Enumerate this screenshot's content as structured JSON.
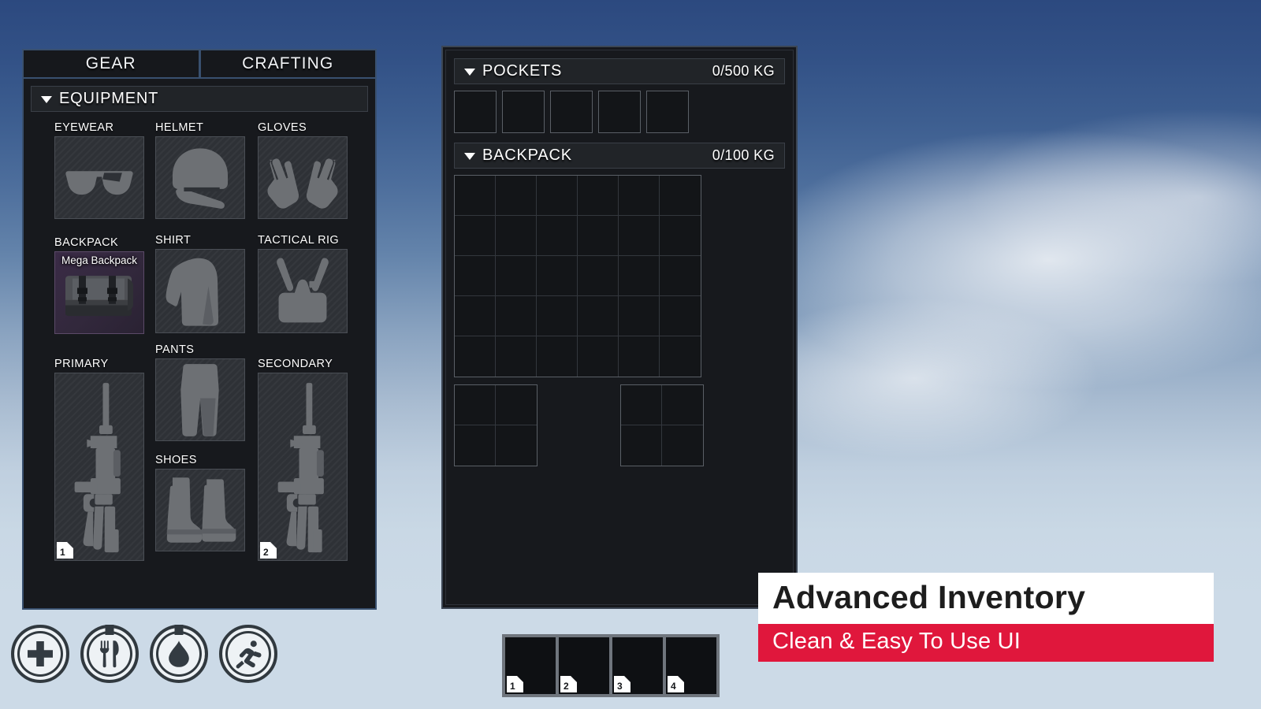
{
  "tabs": [
    {
      "label": "GEAR",
      "active": true
    },
    {
      "label": "CRAFTING",
      "active": false
    }
  ],
  "equipment_section": {
    "title": "EQUIPMENT",
    "caret": "chevron-down-icon"
  },
  "equipment_slots": [
    {
      "id": "eyewear",
      "label": "EYEWEAR",
      "item": null,
      "hotkey": null,
      "icon": "sunglasses-icon"
    },
    {
      "id": "helmet",
      "label": "HELMET",
      "item": null,
      "hotkey": null,
      "icon": "helmet-icon"
    },
    {
      "id": "gloves",
      "label": "GLOVES",
      "item": null,
      "hotkey": null,
      "icon": "gloves-icon"
    },
    {
      "id": "backpack",
      "label": "BACKPACK",
      "item": "Mega Backpack",
      "hotkey": null,
      "icon": "backpack-icon"
    },
    {
      "id": "shirt",
      "label": "SHIRT",
      "item": null,
      "hotkey": null,
      "icon": "shirt-icon"
    },
    {
      "id": "rig",
      "label": "TACTICAL RIG",
      "item": null,
      "hotkey": null,
      "icon": "tactical-rig-icon"
    },
    {
      "id": "primary",
      "label": "PRIMARY",
      "item": null,
      "hotkey": "1",
      "icon": "rifle-icon"
    },
    {
      "id": "pants",
      "label": "PANTS",
      "item": null,
      "hotkey": null,
      "icon": "pants-icon"
    },
    {
      "id": "secondary",
      "label": "SECONDARY",
      "item": null,
      "hotkey": "2",
      "icon": "rifle-icon"
    },
    {
      "id": "shoes",
      "label": "SHOES",
      "item": null,
      "hotkey": null,
      "icon": "boots-icon"
    }
  ],
  "pockets": {
    "title": "POCKETS",
    "capacity": "0/500 KG",
    "slot_count": 5
  },
  "backpack_storage": {
    "title": "BACKPACK",
    "capacity": "0/100 KG",
    "main_grid": {
      "cols": 6,
      "rows": 5
    },
    "sub_grids": [
      {
        "cols": 2,
        "rows": 2
      },
      {
        "cols": 2,
        "rows": 2
      }
    ]
  },
  "status_icons": [
    {
      "id": "health",
      "name": "health-cross-icon"
    },
    {
      "id": "food",
      "name": "fork-knife-icon"
    },
    {
      "id": "water",
      "name": "water-drop-icon"
    },
    {
      "id": "stamina",
      "name": "running-man-icon"
    }
  ],
  "hotbar": {
    "slots": [
      {
        "key": "1",
        "item": null
      },
      {
        "key": "2",
        "item": null
      },
      {
        "key": "3",
        "item": null
      },
      {
        "key": "4",
        "item": null
      }
    ]
  },
  "brand": {
    "title": "Advanced Inventory",
    "subtitle": "Clean & Easy To Use UI",
    "accent_color": "#e0173c",
    "title_bg": "#ffffff"
  },
  "colors": {
    "panel_bg": "#17191d",
    "panel_border": "#39506f",
    "slot_bg": "#2e3136",
    "slot_border": "#4a4e55",
    "header_bg": "#212428",
    "equipped_tint": "#3a2b46",
    "sky_top": "#2c497f",
    "sky_bottom": "#ccdae7"
  }
}
